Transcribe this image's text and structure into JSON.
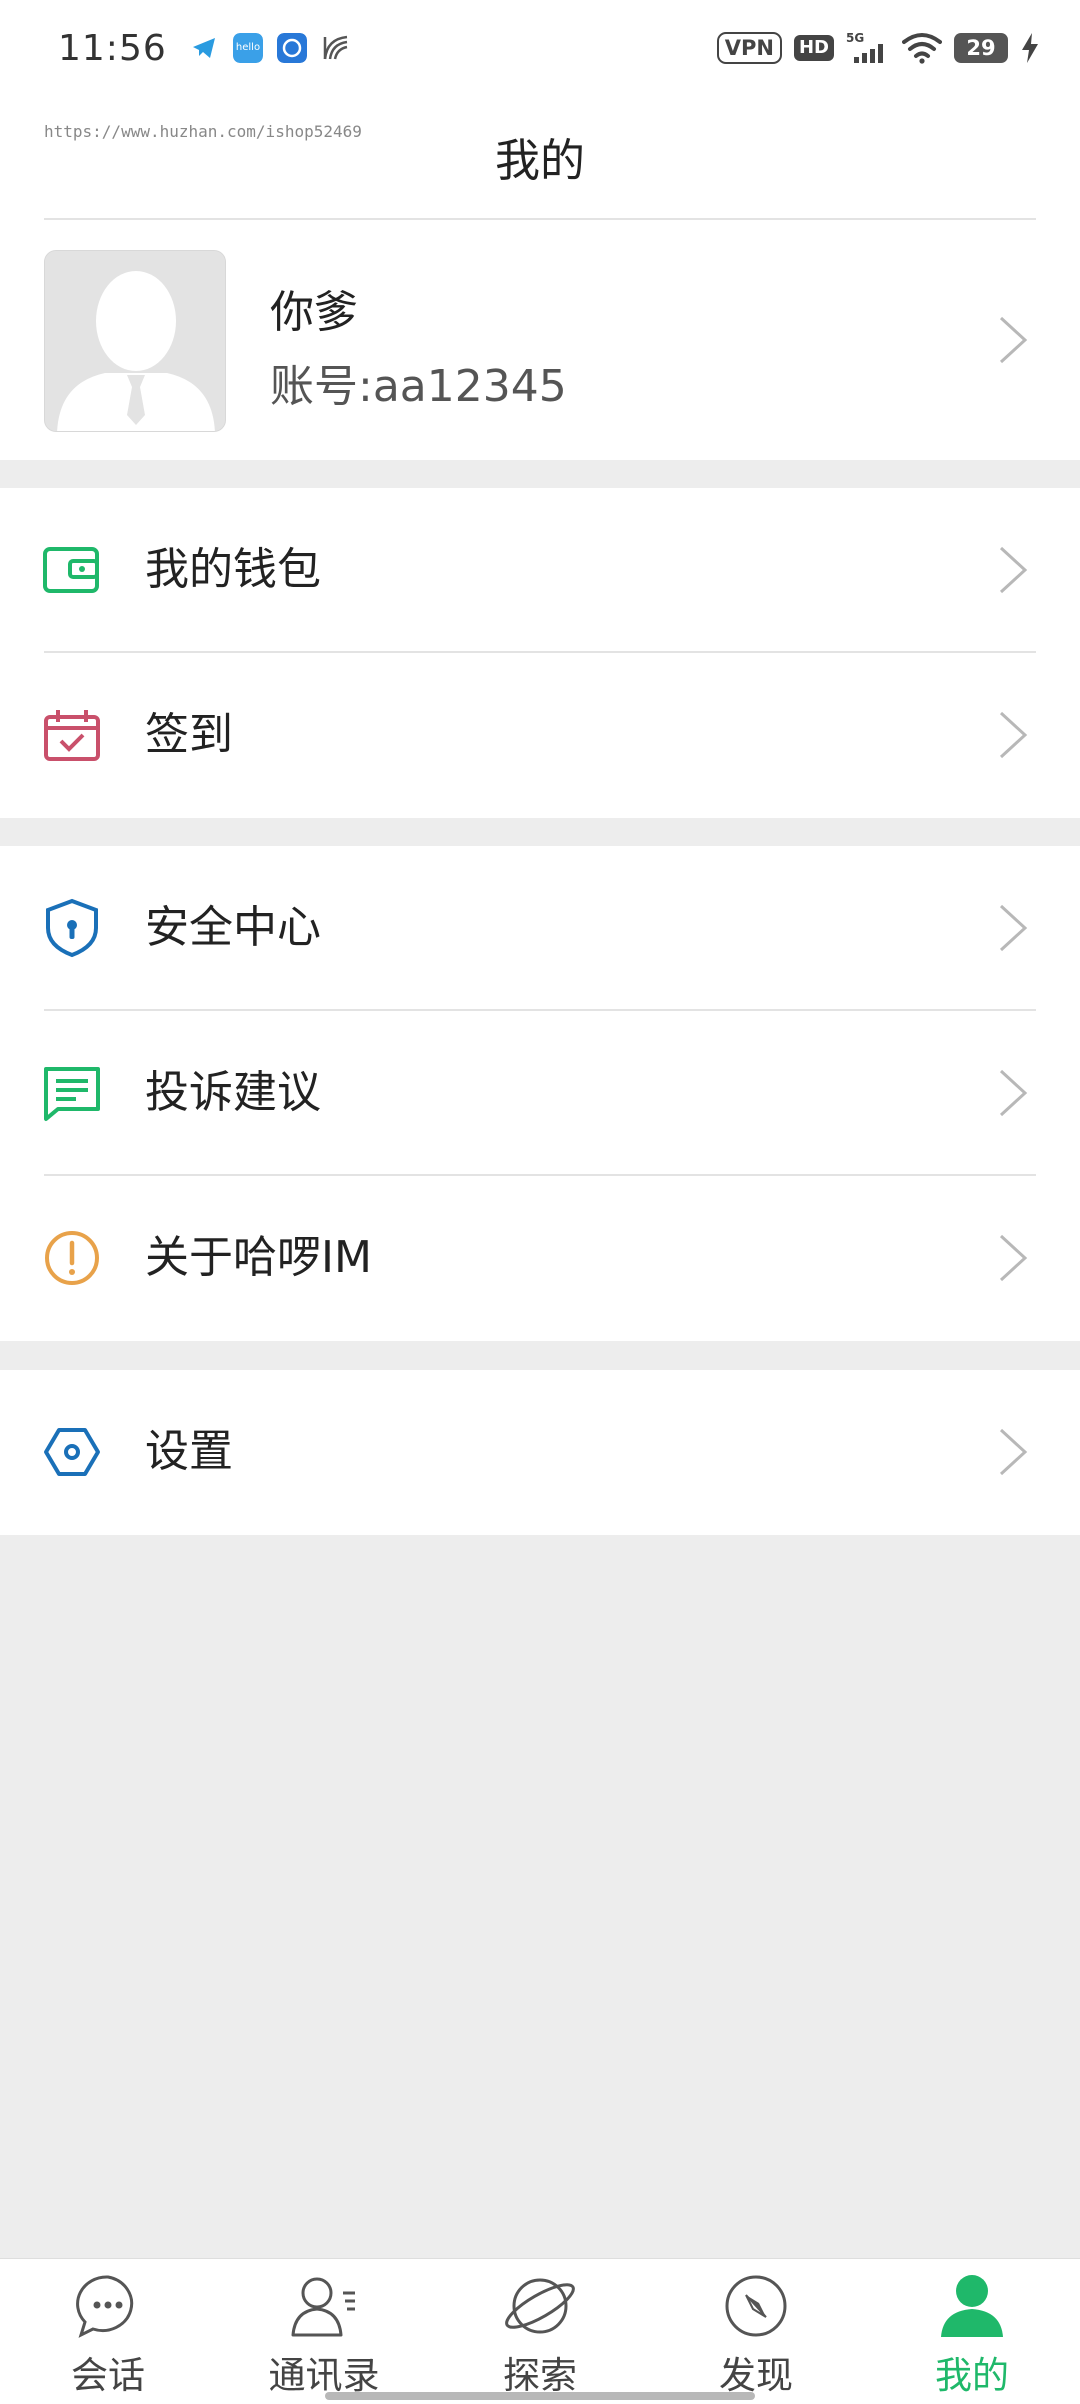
{
  "status_bar": {
    "time": "11:56",
    "vpn": "VPN",
    "hd": "HD",
    "network": "5G",
    "battery": "29"
  },
  "watermark": "https://www.huzhan.com/ishop52469",
  "page_title": "我的",
  "profile": {
    "name": "你爹",
    "account": "账号:aa12345"
  },
  "groups": [
    {
      "items": [
        {
          "label": "我的钱包",
          "icon": "wallet-icon",
          "color": "#1fb86a"
        },
        {
          "label": "签到",
          "icon": "calendar-check-icon",
          "color": "#c9506b"
        }
      ]
    },
    {
      "items": [
        {
          "label": "安全中心",
          "icon": "shield-lock-icon",
          "color": "#1a70b8"
        },
        {
          "label": "投诉建议",
          "icon": "chat-lines-icon",
          "color": "#1fb86a"
        },
        {
          "label": "关于哈啰IM",
          "icon": "info-exclaim-icon",
          "color": "#e8a24a"
        }
      ]
    },
    {
      "items": [
        {
          "label": "设置",
          "icon": "settings-hex-icon",
          "color": "#1a70b8"
        }
      ]
    }
  ],
  "tabs": [
    {
      "label": "会话",
      "icon": "chat-bubble-icon"
    },
    {
      "label": "通讯录",
      "icon": "contacts-icon"
    },
    {
      "label": "探索",
      "icon": "planet-icon"
    },
    {
      "label": "发现",
      "icon": "compass-icon"
    },
    {
      "label": "我的",
      "icon": "person-icon",
      "active": true
    }
  ],
  "colors": {
    "accent": "#1fb86a",
    "background": "#ededed",
    "card": "#ffffff"
  }
}
